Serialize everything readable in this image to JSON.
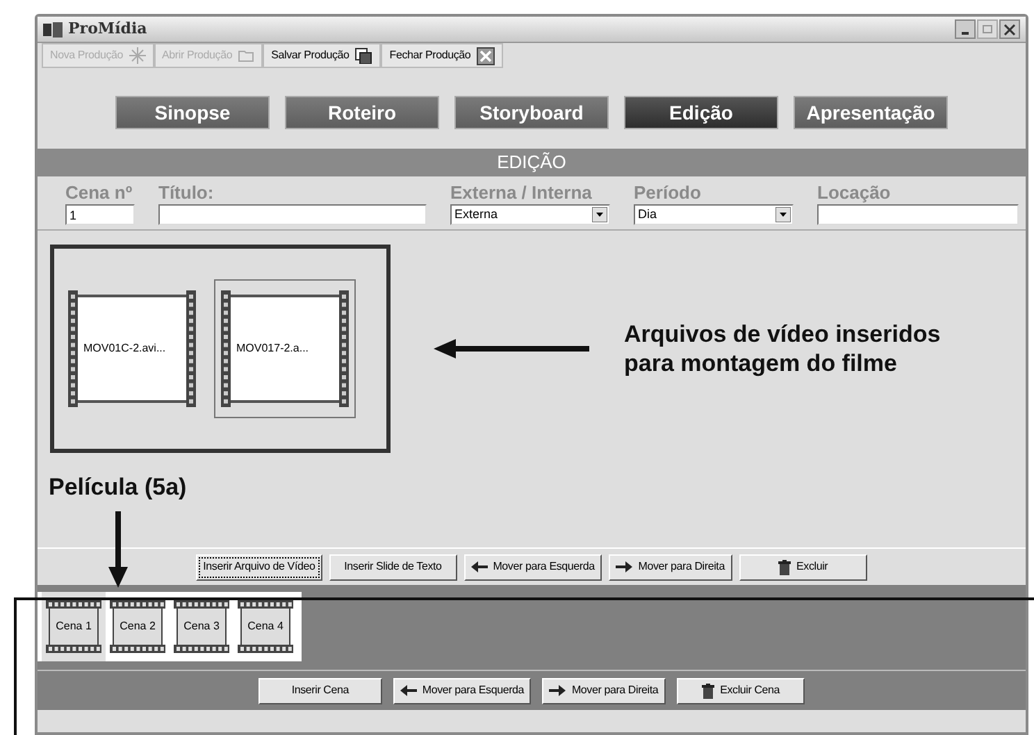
{
  "window": {
    "title": "ProMídia"
  },
  "toolbar": [
    {
      "label": "Nova Produção",
      "kind": "sparkle",
      "disabled": true
    },
    {
      "label": "Abrir Produção",
      "kind": "folder",
      "disabled": true
    },
    {
      "label": "Salvar Produção",
      "kind": "save",
      "disabled": false
    },
    {
      "label": "Fechar Produção",
      "kind": "close",
      "disabled": false
    }
  ],
  "nav_tabs": [
    {
      "label": "Sinopse",
      "selected": false
    },
    {
      "label": "Roteiro",
      "selected": false
    },
    {
      "label": "Storyboard",
      "selected": false
    },
    {
      "label": "Edição",
      "selected": true
    },
    {
      "label": "Apresentação",
      "selected": false
    }
  ],
  "section_title": "EDIÇÃO",
  "fields": [
    {
      "label": "Cena nº",
      "kind": "text",
      "value": "1"
    },
    {
      "label": "Título:",
      "kind": "text"
    },
    {
      "label": "Externa / Interna",
      "kind": "select",
      "value": "Externa"
    },
    {
      "label": "Período",
      "kind": "select",
      "value": "Dia"
    },
    {
      "label": "Locação",
      "kind": "text"
    }
  ],
  "clips": [
    {
      "name": "MOV01C-2.avi...",
      "selected": false
    },
    {
      "name": "MOV017-2.a...",
      "selected": true
    }
  ],
  "clip_buttons": [
    {
      "label": "Inserir Arquivo de Vídeo",
      "focused": true
    },
    {
      "label": "Inserir Slide de Texto",
      "focused": false
    },
    {
      "label": "Mover para Esquerda",
      "kind": "left",
      "focused": false
    },
    {
      "label": "Mover para Direita",
      "kind": "right",
      "focused": false
    },
    {
      "label": "Excluir",
      "kind": "trash",
      "focused": false
    }
  ],
  "scenes": [
    {
      "label": "Cena 1",
      "selected": true
    },
    {
      "label": "Cena 2",
      "selected": false
    },
    {
      "label": "Cena 3",
      "selected": false
    },
    {
      "label": "Cena 4",
      "selected": false
    }
  ],
  "scene_buttons": [
    {
      "label": "Inserir Cena"
    },
    {
      "label": "Mover para Esquerda",
      "kind": "left"
    },
    {
      "label": "Mover para Direita",
      "kind": "right"
    },
    {
      "label": "Excluir Cena",
      "kind": "trash"
    }
  ],
  "annotations": {
    "clips_note": [
      "Arquivos de vídeo inseridos",
      "para montagem do filme"
    ],
    "film_label": "Película (5a)"
  }
}
